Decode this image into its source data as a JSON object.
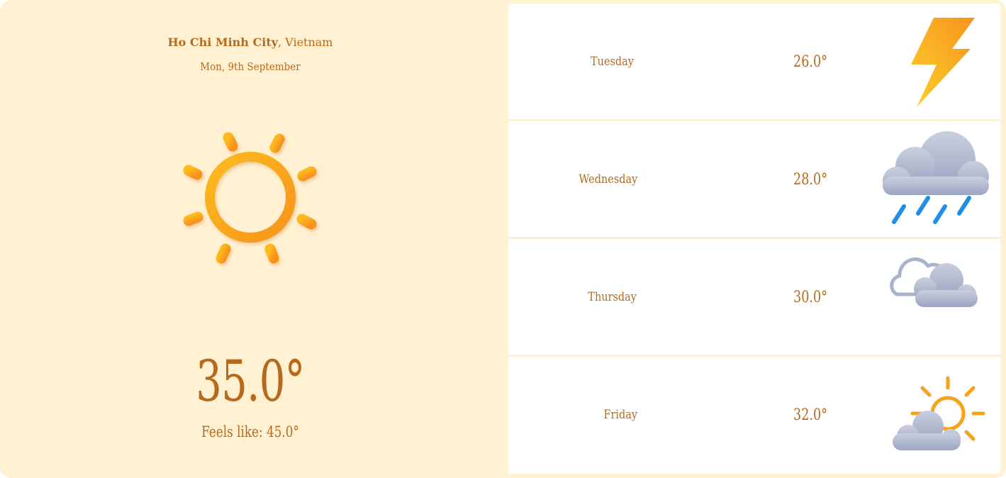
{
  "location": {
    "city": "Ho Chi Minh City",
    "country": ", Vietnam"
  },
  "current": {
    "date": "Mon, 9th September",
    "temperature": "35.0°",
    "feels_like": "Feels like: 45.0°",
    "icon": "sun-icon"
  },
  "forecast": [
    {
      "day": "Tuesday",
      "temperature": "26.0°",
      "icon": "lightning-icon"
    },
    {
      "day": "Wednesday",
      "temperature": "28.0°",
      "icon": "rain-cloud-icon"
    },
    {
      "day": "Thursday",
      "temperature": "30.0°",
      "icon": "cloudy-icon"
    },
    {
      "day": "Friday",
      "temperature": "32.0°",
      "icon": "partly-cloudy-icon"
    }
  ],
  "colors": {
    "background": "#fff1d2",
    "text": "#b86a1c",
    "sun": "#fba71c",
    "cloud": "#a9b3cb",
    "rain": "#1f8ee8"
  }
}
